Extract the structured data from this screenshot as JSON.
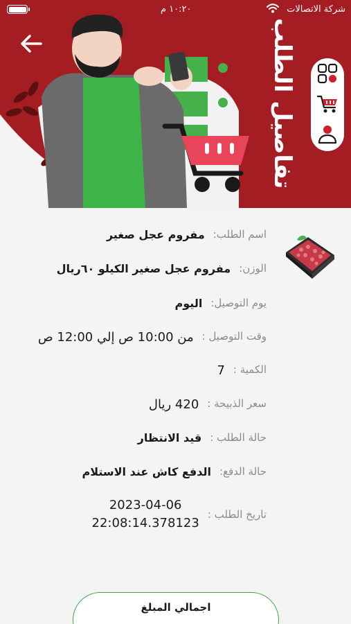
{
  "status_bar": {
    "carrier": "شركة الاتصالات",
    "time": "١٠:٢٠ م"
  },
  "header": {
    "title": "تفاصيل الطلب",
    "background_color": "#a41d22",
    "icons": [
      "grid-icon",
      "cart-icon",
      "profile-icon"
    ]
  },
  "order": {
    "name_label": "اسم الطلب:",
    "name_value": "مفروم عجل صغير",
    "weight_label": "الوزن:",
    "weight_value": "مفروم عجل صغير الكيلو ٦٠ريال",
    "delivery_day_label": "يوم التوصيل:",
    "delivery_day_value": "اليوم",
    "delivery_time_label": "وقت التوصيل :",
    "delivery_time_value": "من 10:00 ص إلي 12:00 ص",
    "quantity_label": "الكمية :",
    "quantity_value": "7",
    "price_label": "سعر الذبيحة :",
    "price_value": "420 ريال",
    "status_label": "حالة الطلب :",
    "status_value": "قيد الانتظار",
    "payment_label": "حالة الدفع:",
    "payment_value": "الدفع كاش عند الاستلام",
    "date_label": "تاريخ الطلب :",
    "date_value_line1": "2023-04-06",
    "date_value_line2": "22:08:14.378123"
  },
  "footer": {
    "total_label": "اجمالي المبلغ",
    "accent_color": "#3aa845"
  }
}
